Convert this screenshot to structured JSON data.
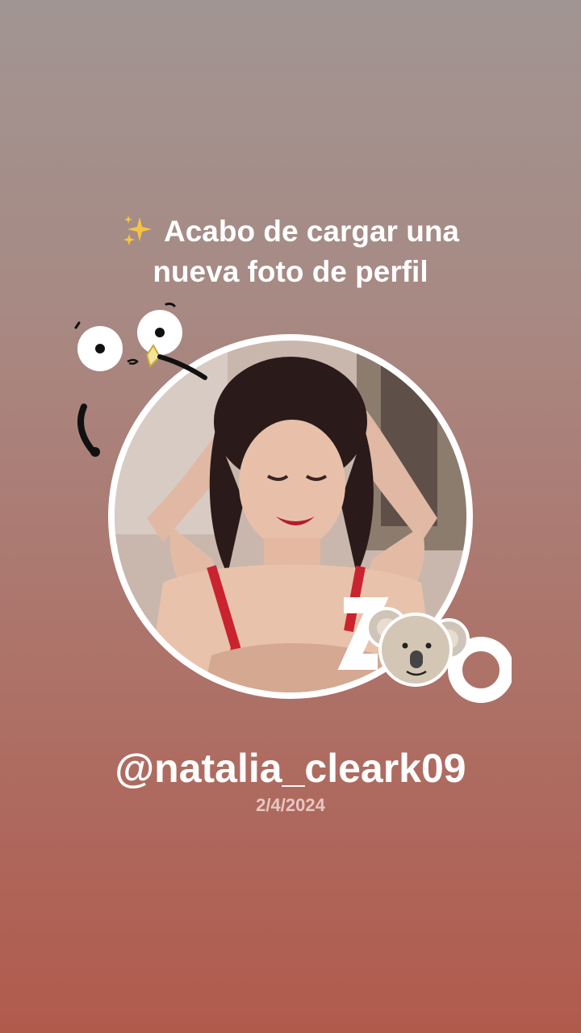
{
  "headline": {
    "icon": "sparkles-icon",
    "line1": "Acabo de cargar una",
    "line2": "nueva foto de perfil"
  },
  "profile": {
    "photo": "profile-photo",
    "username": "@natalia_cleark09",
    "date": "2/4/2024"
  },
  "stickers": {
    "left": "cartoon-eyes-sticker",
    "right": "zoo-koala-sticker"
  },
  "colors": {
    "gradient_top": "#a19592",
    "gradient_bottom": "#b05a4c",
    "text": "#ffffff",
    "date_text": "#e7c7c1",
    "sparkle": "#f5c542"
  }
}
